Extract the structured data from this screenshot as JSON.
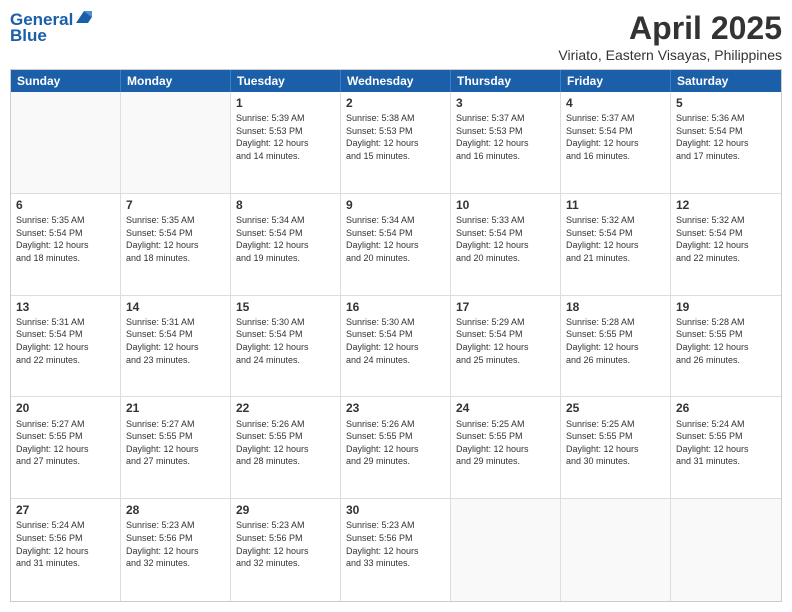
{
  "logo": {
    "line1": "General",
    "line2": "Blue"
  },
  "title": "April 2025",
  "subtitle": "Viriato, Eastern Visayas, Philippines",
  "header_days": [
    "Sunday",
    "Monday",
    "Tuesday",
    "Wednesday",
    "Thursday",
    "Friday",
    "Saturday"
  ],
  "weeks": [
    [
      {
        "day": "",
        "info": ""
      },
      {
        "day": "",
        "info": ""
      },
      {
        "day": "1",
        "info": "Sunrise: 5:39 AM\nSunset: 5:53 PM\nDaylight: 12 hours\nand 14 minutes."
      },
      {
        "day": "2",
        "info": "Sunrise: 5:38 AM\nSunset: 5:53 PM\nDaylight: 12 hours\nand 15 minutes."
      },
      {
        "day": "3",
        "info": "Sunrise: 5:37 AM\nSunset: 5:53 PM\nDaylight: 12 hours\nand 16 minutes."
      },
      {
        "day": "4",
        "info": "Sunrise: 5:37 AM\nSunset: 5:54 PM\nDaylight: 12 hours\nand 16 minutes."
      },
      {
        "day": "5",
        "info": "Sunrise: 5:36 AM\nSunset: 5:54 PM\nDaylight: 12 hours\nand 17 minutes."
      }
    ],
    [
      {
        "day": "6",
        "info": "Sunrise: 5:35 AM\nSunset: 5:54 PM\nDaylight: 12 hours\nand 18 minutes."
      },
      {
        "day": "7",
        "info": "Sunrise: 5:35 AM\nSunset: 5:54 PM\nDaylight: 12 hours\nand 18 minutes."
      },
      {
        "day": "8",
        "info": "Sunrise: 5:34 AM\nSunset: 5:54 PM\nDaylight: 12 hours\nand 19 minutes."
      },
      {
        "day": "9",
        "info": "Sunrise: 5:34 AM\nSunset: 5:54 PM\nDaylight: 12 hours\nand 20 minutes."
      },
      {
        "day": "10",
        "info": "Sunrise: 5:33 AM\nSunset: 5:54 PM\nDaylight: 12 hours\nand 20 minutes."
      },
      {
        "day": "11",
        "info": "Sunrise: 5:32 AM\nSunset: 5:54 PM\nDaylight: 12 hours\nand 21 minutes."
      },
      {
        "day": "12",
        "info": "Sunrise: 5:32 AM\nSunset: 5:54 PM\nDaylight: 12 hours\nand 22 minutes."
      }
    ],
    [
      {
        "day": "13",
        "info": "Sunrise: 5:31 AM\nSunset: 5:54 PM\nDaylight: 12 hours\nand 22 minutes."
      },
      {
        "day": "14",
        "info": "Sunrise: 5:31 AM\nSunset: 5:54 PM\nDaylight: 12 hours\nand 23 minutes."
      },
      {
        "day": "15",
        "info": "Sunrise: 5:30 AM\nSunset: 5:54 PM\nDaylight: 12 hours\nand 24 minutes."
      },
      {
        "day": "16",
        "info": "Sunrise: 5:30 AM\nSunset: 5:54 PM\nDaylight: 12 hours\nand 24 minutes."
      },
      {
        "day": "17",
        "info": "Sunrise: 5:29 AM\nSunset: 5:54 PM\nDaylight: 12 hours\nand 25 minutes."
      },
      {
        "day": "18",
        "info": "Sunrise: 5:28 AM\nSunset: 5:55 PM\nDaylight: 12 hours\nand 26 minutes."
      },
      {
        "day": "19",
        "info": "Sunrise: 5:28 AM\nSunset: 5:55 PM\nDaylight: 12 hours\nand 26 minutes."
      }
    ],
    [
      {
        "day": "20",
        "info": "Sunrise: 5:27 AM\nSunset: 5:55 PM\nDaylight: 12 hours\nand 27 minutes."
      },
      {
        "day": "21",
        "info": "Sunrise: 5:27 AM\nSunset: 5:55 PM\nDaylight: 12 hours\nand 27 minutes."
      },
      {
        "day": "22",
        "info": "Sunrise: 5:26 AM\nSunset: 5:55 PM\nDaylight: 12 hours\nand 28 minutes."
      },
      {
        "day": "23",
        "info": "Sunrise: 5:26 AM\nSunset: 5:55 PM\nDaylight: 12 hours\nand 29 minutes."
      },
      {
        "day": "24",
        "info": "Sunrise: 5:25 AM\nSunset: 5:55 PM\nDaylight: 12 hours\nand 29 minutes."
      },
      {
        "day": "25",
        "info": "Sunrise: 5:25 AM\nSunset: 5:55 PM\nDaylight: 12 hours\nand 30 minutes."
      },
      {
        "day": "26",
        "info": "Sunrise: 5:24 AM\nSunset: 5:55 PM\nDaylight: 12 hours\nand 31 minutes."
      }
    ],
    [
      {
        "day": "27",
        "info": "Sunrise: 5:24 AM\nSunset: 5:56 PM\nDaylight: 12 hours\nand 31 minutes."
      },
      {
        "day": "28",
        "info": "Sunrise: 5:23 AM\nSunset: 5:56 PM\nDaylight: 12 hours\nand 32 minutes."
      },
      {
        "day": "29",
        "info": "Sunrise: 5:23 AM\nSunset: 5:56 PM\nDaylight: 12 hours\nand 32 minutes."
      },
      {
        "day": "30",
        "info": "Sunrise: 5:23 AM\nSunset: 5:56 PM\nDaylight: 12 hours\nand 33 minutes."
      },
      {
        "day": "",
        "info": ""
      },
      {
        "day": "",
        "info": ""
      },
      {
        "day": "",
        "info": ""
      }
    ]
  ]
}
